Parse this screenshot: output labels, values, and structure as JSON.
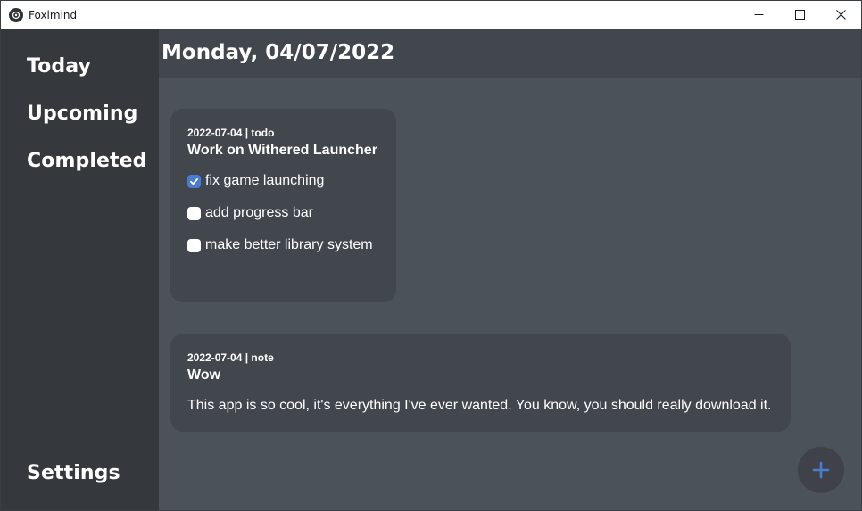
{
  "window": {
    "title": "Foxlmind",
    "controls": [
      "minimize-icon",
      "maximize-icon",
      "close-icon"
    ]
  },
  "sidebar": {
    "items": [
      {
        "label": "Today"
      },
      {
        "label": "Upcoming"
      },
      {
        "label": "Completed"
      }
    ],
    "settings_label": "Settings"
  },
  "header": {
    "title": "Monday, 04/07/2022"
  },
  "cards": [
    {
      "meta": "2022-07-04 | todo",
      "title": "Work on Withered Launcher",
      "tasks": [
        {
          "label": "fix game launching",
          "checked": true
        },
        {
          "label": "add progress bar",
          "checked": false
        },
        {
          "label": "make better library system",
          "checked": false
        }
      ]
    },
    {
      "meta": "2022-07-04 | note",
      "title": "Wow",
      "body": "This app is so cool, it's everything I've ever wanted. You know, you should really download it."
    }
  ],
  "fab": {
    "icon": "plus-icon",
    "color": "#4a7ccf"
  },
  "colors": {
    "sidebar_bg": "#35393d",
    "header_bg": "#42474d",
    "main_bg": "#4c5259",
    "card_bg": "#42474d",
    "accent": "#4a7ccf"
  }
}
